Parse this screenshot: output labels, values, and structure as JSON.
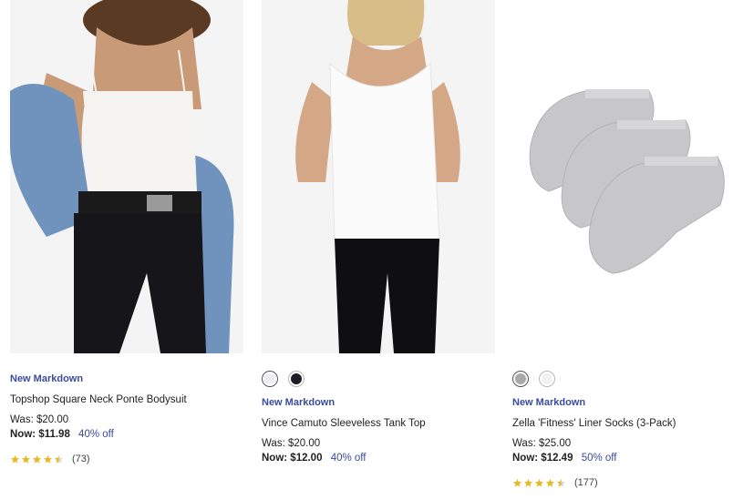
{
  "products": [
    {
      "badge": "New Markdown",
      "title": "Topshop Square Neck Ponte Bodysuit",
      "was": "Was: $20.00",
      "now": "Now: $11.98",
      "discount": "40% off",
      "rating": 4.5,
      "review_count": "(73)",
      "swatches": []
    },
    {
      "badge": "New Markdown",
      "title": "Vince Camuto Sleeveless Tank Top",
      "was": "Was: $20.00",
      "now": "Now: $12.00",
      "discount": "40% off",
      "swatches": [
        {
          "color": "#f1eef3",
          "selected": true
        },
        {
          "color": "#1e1c26",
          "selected": false
        }
      ]
    },
    {
      "badge": "New Markdown",
      "title": "Zella 'Fitness' Liner Socks (3-Pack)",
      "was": "Was: $25.00",
      "now": "Now: $12.49",
      "discount": "50% off",
      "rating": 4.5,
      "review_count": "(177)",
      "swatches": [
        {
          "color": "#a9a9a9",
          "selected": true
        },
        {
          "color": "#f2f2f2",
          "selected": false
        }
      ]
    }
  ],
  "colors": {
    "accent": "#3a4aa0",
    "star": "#e8b923"
  }
}
